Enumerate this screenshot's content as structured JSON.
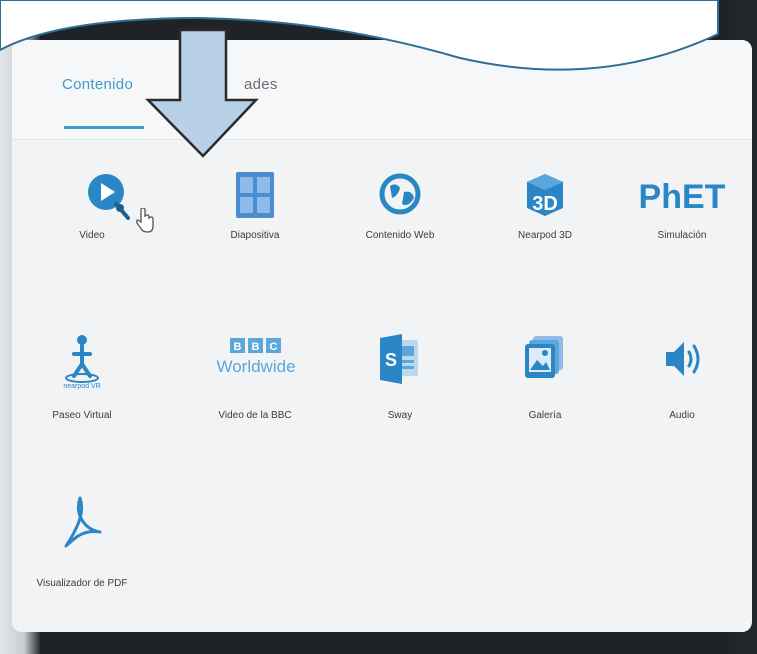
{
  "tabs": [
    {
      "label": "Contenido",
      "active": true
    },
    {
      "label": "ades",
      "active": false
    }
  ],
  "tiles": [
    {
      "label": "Video",
      "icon": "video-play-icon"
    },
    {
      "label": "Diapositiva",
      "icon": "slides-grid-icon"
    },
    {
      "label": "Contenido Web",
      "icon": "globe-icon"
    },
    {
      "label": "Nearpod 3D",
      "icon": "3d-cube-icon"
    },
    {
      "label": "Simulación",
      "icon": "phet-logo"
    },
    {
      "label": "Paseo Virtual",
      "icon": "virtual-field-trip-icon"
    },
    {
      "label": "Video de la BBC",
      "icon": "bbc-worldwide-logo"
    },
    {
      "label": "Sway",
      "icon": "sway-logo"
    },
    {
      "label": "Galería",
      "icon": "gallery-icon"
    },
    {
      "label": "Audio",
      "icon": "speaker-icon"
    },
    {
      "label": "Visualizador de PDF",
      "icon": "pdf-icon"
    }
  ],
  "logos": {
    "phet": "PhET",
    "bbc_letters": [
      "B",
      "B",
      "C"
    ],
    "bbc_sub": "Worldwide",
    "nearpod_3d": "3D",
    "nearpod_vr": "nearpod VR",
    "sway_letter": "S"
  },
  "colors": {
    "accent": "#3d9bd0",
    "panel": "#f1f3f5",
    "callout_fill": "#ffffff",
    "callout_stroke": "#2f6f95",
    "arrow_fill": "#b8d0e8",
    "arrow_stroke": "#2b2b2b"
  }
}
